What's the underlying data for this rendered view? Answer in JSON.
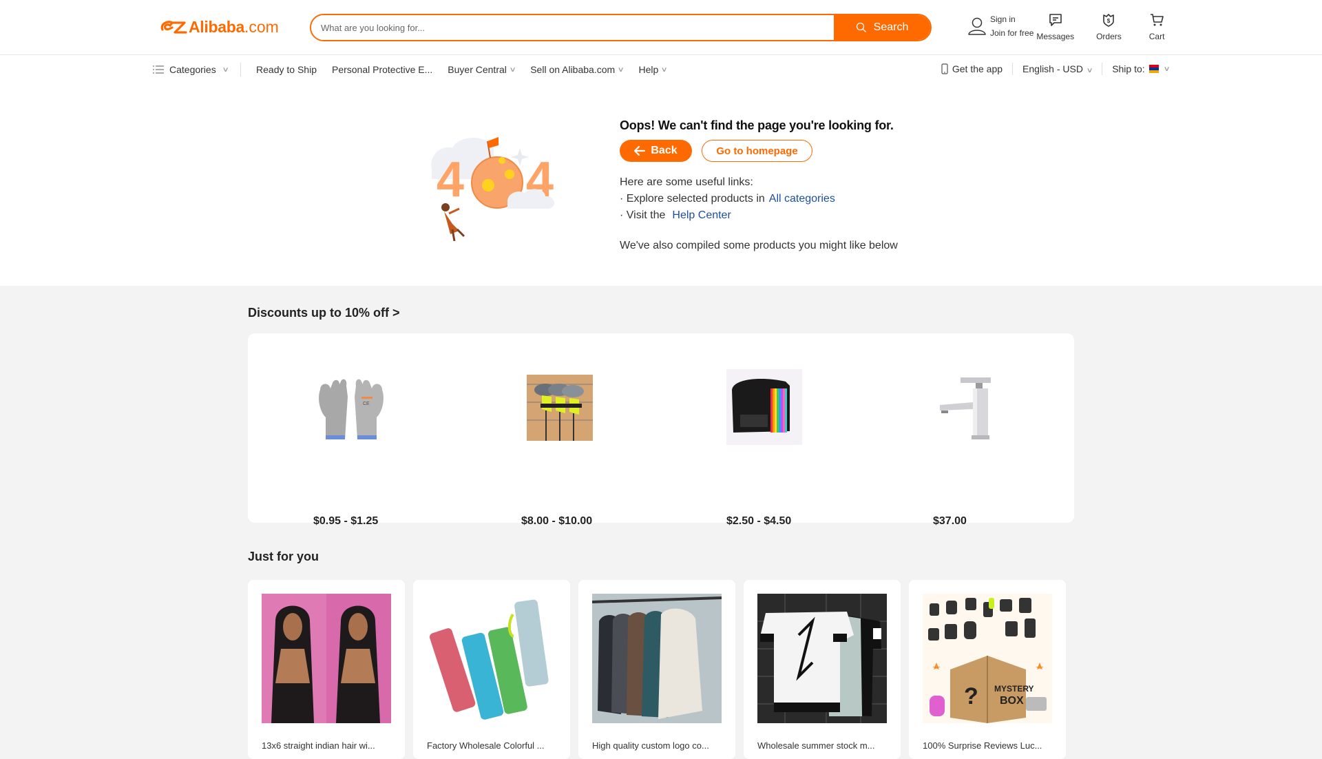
{
  "header": {
    "logo_brand": "Alibaba",
    "logo_suffix": ".com",
    "search_placeholder": "What are you looking for...",
    "search_value": "",
    "search_button": "Search",
    "sign_in": "Sign in",
    "join": "Join for free",
    "messages": "Messages",
    "orders": "Orders",
    "cart": "Cart"
  },
  "nav": {
    "categories": "Categories",
    "items": [
      {
        "label": "Ready to Ship",
        "dropdown": false
      },
      {
        "label": "Personal Protective E...",
        "dropdown": false
      },
      {
        "label": "Buyer Central",
        "dropdown": true
      },
      {
        "label": "Sell on Alibaba.com",
        "dropdown": true
      },
      {
        "label": "Help",
        "dropdown": true
      }
    ],
    "get_app": "Get the app",
    "language_currency": "English - USD",
    "ship_to": "Ship to:",
    "ship_to_flag": [
      "#d90012",
      "#0033a0",
      "#f2a800"
    ]
  },
  "error": {
    "illustration": "404",
    "heading": "Oops! We can't find the page you're looking for.",
    "back_button": "Back",
    "home_button": "Go to homepage",
    "links_intro": "Here are some useful links:",
    "link1_prefix": "· Explore selected products in",
    "link1_text": "All categories",
    "link2_prefix": "· Visit the",
    "link2_text": "Help Center",
    "also": "We've also compiled some products you might like below"
  },
  "discounts": {
    "title": "Discounts up to 10%  off >",
    "items": [
      {
        "name": "cut-resistant gloves",
        "price": "$0.95 - $1.25"
      },
      {
        "name": "golf club display rack",
        "price": "$8.00 - $10.00"
      },
      {
        "name": "expanding file folder",
        "price": "$2.50 - $4.50"
      },
      {
        "name": "basin faucet",
        "price": "$37.00"
      }
    ]
  },
  "just_for_you": {
    "title": "Just for you",
    "items": [
      {
        "title": "13x6 straight indian hair wi..."
      },
      {
        "title": "Factory Wholesale Colorful ..."
      },
      {
        "title": "High quality custom logo co..."
      },
      {
        "title": "Wholesale summer stock m..."
      },
      {
        "title": "100% Surprise Reviews Luc..."
      }
    ]
  },
  "colors": {
    "accent": "#ff6a00",
    "link": "#1d4ea0",
    "page_bg": "#f3f3f3"
  }
}
